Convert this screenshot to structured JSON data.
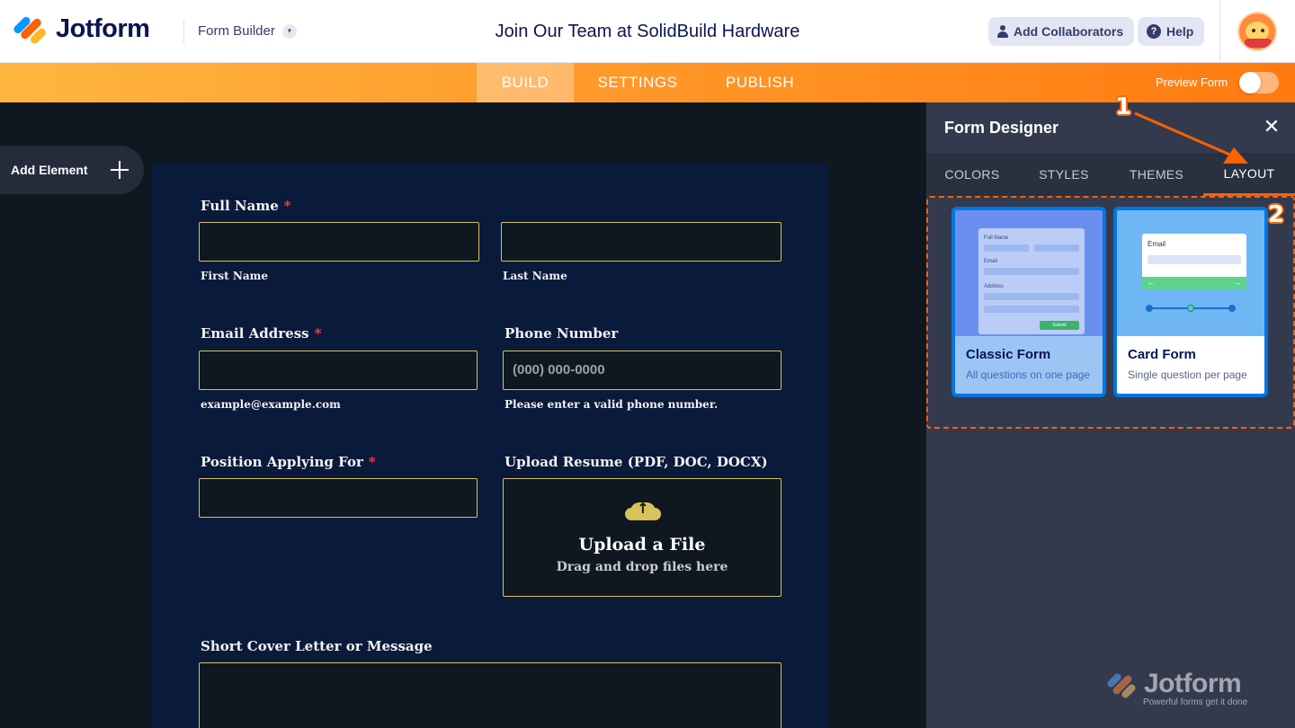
{
  "header": {
    "brand": "Jotform",
    "builder_label": "Form Builder",
    "form_title": "Join Our Team at SolidBuild Hardware",
    "add_collaborators": "Add Collaborators",
    "help": "Help"
  },
  "nav": {
    "tabs": [
      "BUILD",
      "SETTINGS",
      "PUBLISH"
    ],
    "active": "BUILD",
    "preview_label": "Preview Form",
    "preview_on": false
  },
  "sidebar": {
    "add_element": "Add Element"
  },
  "form": {
    "full_name": {
      "label": "Full Name",
      "required": "*",
      "first": "First Name",
      "last": "Last Name"
    },
    "email": {
      "label": "Email Address",
      "required": "*",
      "sublabel": "example@example.com"
    },
    "phone": {
      "label": "Phone Number",
      "placeholder": "(000) 000-0000",
      "sublabel": "Please enter a valid phone number."
    },
    "position": {
      "label": "Position Applying For",
      "required": "*"
    },
    "resume": {
      "label": "Upload Resume (PDF, DOC, DOCX)",
      "button": "Upload a File",
      "hint": "Drag and drop files here"
    },
    "cover": {
      "label": "Short Cover Letter or Message"
    }
  },
  "designer": {
    "title": "Form Designer",
    "tabs": [
      "COLORS",
      "STYLES",
      "THEMES",
      "LAYOUT"
    ],
    "active_tab": "LAYOUT",
    "layouts": [
      {
        "title": "Classic Form",
        "subtitle": "All questions on one page"
      },
      {
        "title": "Card Form",
        "subtitle": "Single question per page"
      }
    ],
    "classic_thumb": {
      "full_name": "Full Name",
      "email": "Email",
      "address": "Address",
      "submit": "Submit"
    },
    "card_thumb": {
      "email": "Email",
      "prev": "←",
      "next": "→"
    }
  },
  "annotations": [
    "1",
    "2"
  ],
  "watermark": {
    "brand": "Jotform",
    "tagline": "Powerful forms get it done"
  },
  "colors": {
    "accent": "#ff6100",
    "brand_navy": "#0a1551",
    "field_border": "#d8c25a",
    "form_bg": "#0a1a3a",
    "required": "#ff4040"
  }
}
